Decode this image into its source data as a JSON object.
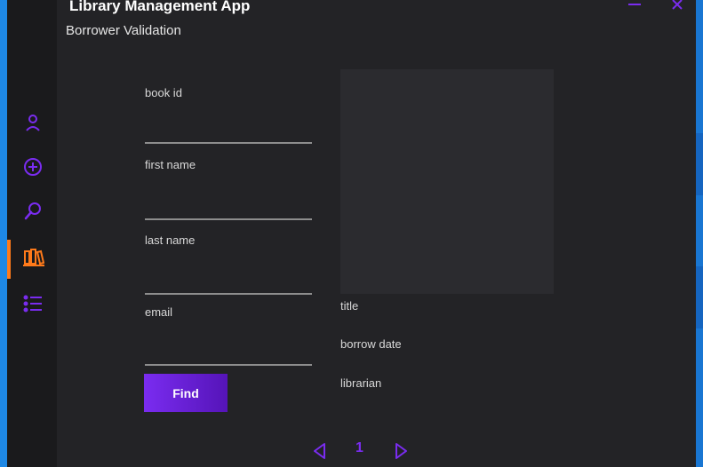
{
  "window": {
    "title": "Library Management App",
    "subtitle": "Borrower Validation"
  },
  "sidebar": {
    "items": [
      {
        "icon": "user-icon",
        "active": false
      },
      {
        "icon": "add-circle-icon",
        "active": false
      },
      {
        "icon": "search-icon",
        "active": false
      },
      {
        "icon": "library-books-icon",
        "active": true
      },
      {
        "icon": "list-icon",
        "active": false
      }
    ]
  },
  "form": {
    "book_id_label": "book id",
    "first_name_label": "first name",
    "last_name_label": "last name",
    "email_label": "email",
    "book_id_value": "",
    "first_name_value": "",
    "last_name_value": "",
    "email_value": "",
    "find_label": "Find"
  },
  "details": {
    "title_label": "title",
    "borrow_date_label": "borrow date",
    "librarian_label": "librarian"
  },
  "pagination": {
    "page": "1"
  },
  "colors": {
    "accent": "#7a2cf0",
    "active": "#ff7a1a",
    "background": "#232326",
    "sidebar": "#1a1a1c"
  }
}
